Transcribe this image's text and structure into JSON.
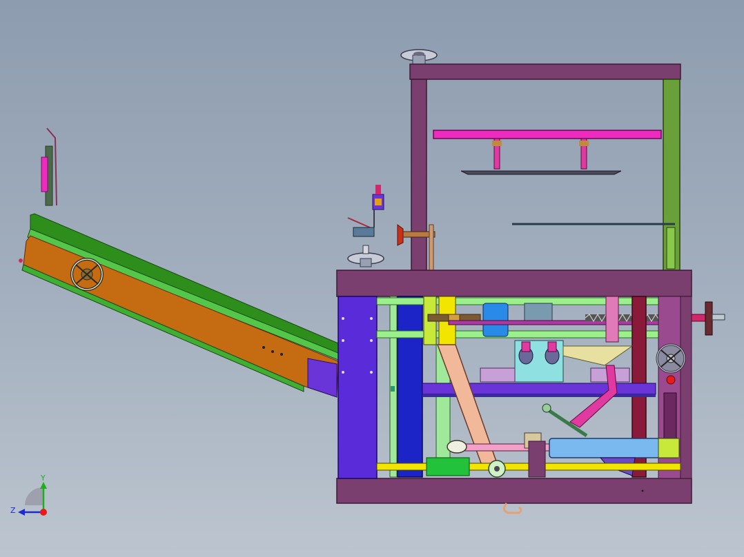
{
  "triad": {
    "y_label": "Y",
    "z_label": "Z"
  },
  "colors": {
    "background_top": "#8d9caf",
    "background_bottom": "#bcc5cf",
    "frame": "#7a3f6f",
    "frame_dark": "#5a2e52",
    "blue_panel": "#5a2bd8",
    "conveyor_green": "#2a8a1a",
    "conveyor_orange": "#c46a10",
    "yellow": "#f2e600",
    "pink": "#ef3cb0",
    "light_green": "#9cf08c"
  },
  "icons": {
    "triad": "coordinate-triad-icon",
    "handwheel": "handwheel-icon"
  }
}
